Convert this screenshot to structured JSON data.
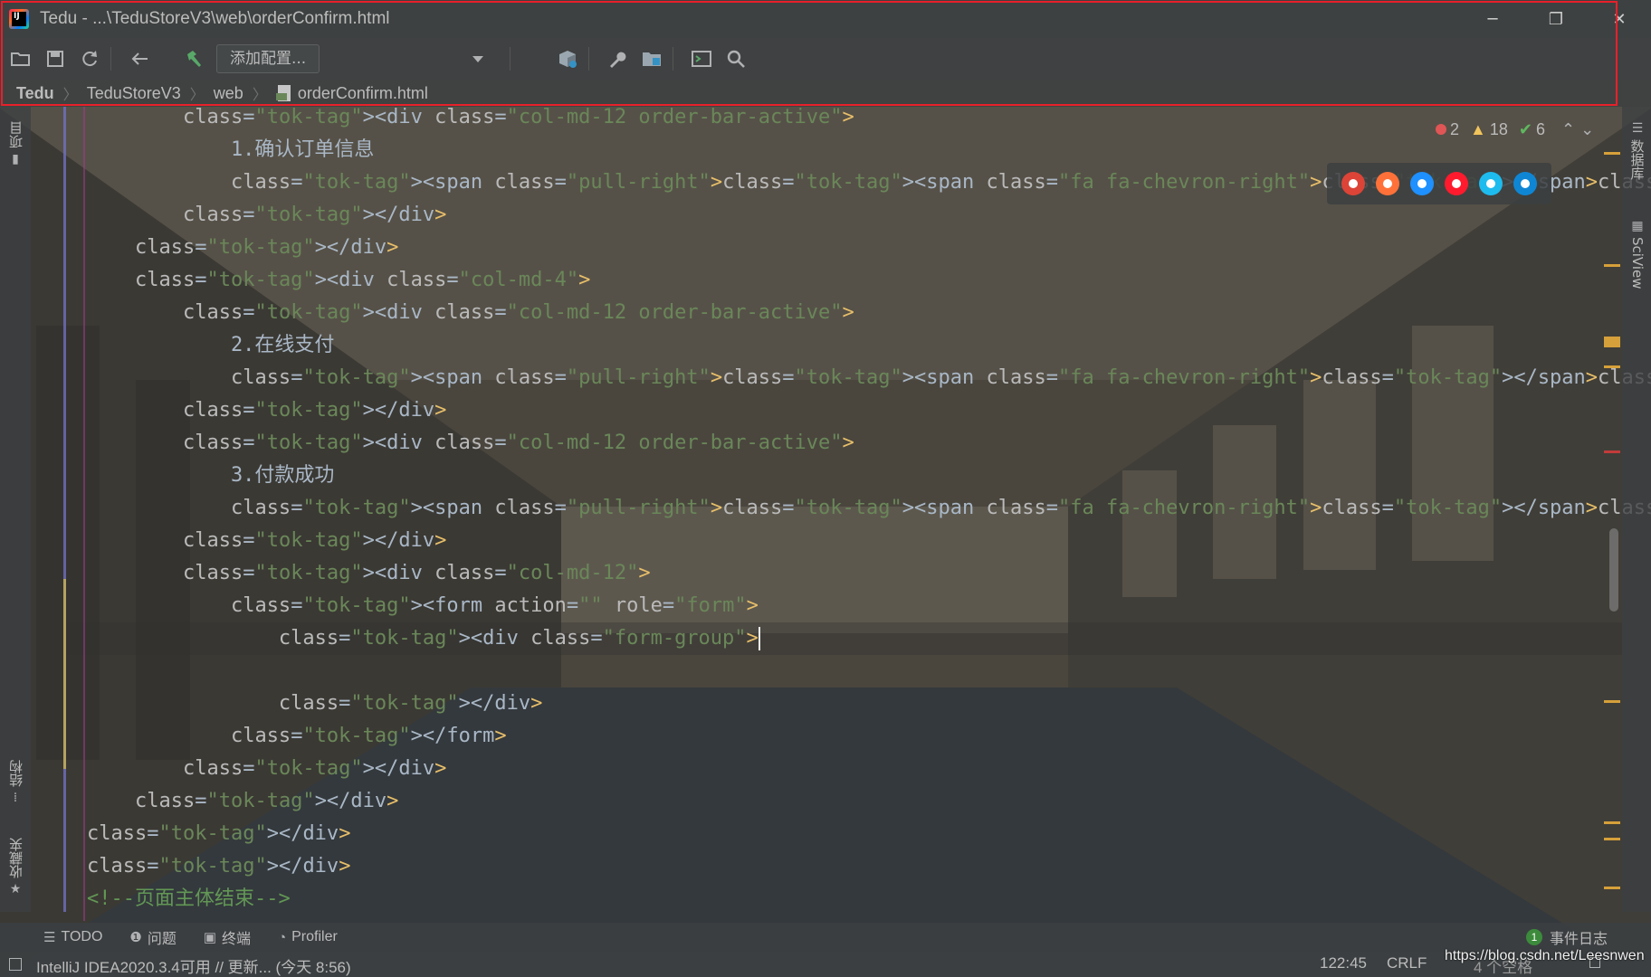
{
  "window": {
    "title": "Tedu - ...\\TeduStoreV3\\web\\orderConfirm.html",
    "logo_text": "IJ",
    "minimize_glyph": "─",
    "maximize_glyph": "❐",
    "close_glyph": "✕"
  },
  "toolbar": {
    "icons": [
      "open-folder-icon",
      "save-icon",
      "sync-icon",
      "back-arrow-icon",
      "build-hammer-icon",
      "run-config-dropdown-icon",
      "package-icon",
      "wrench-icon",
      "project-structure-icon",
      "terminal-icon",
      "search-icon"
    ],
    "run_config_label": "添加配置..."
  },
  "breadcrumb": {
    "items": [
      "Tedu",
      "TeduStoreV3",
      "web",
      "orderConfirm.html"
    ]
  },
  "left_strip": {
    "project_label": "项目",
    "structure_label": "结构",
    "favorites_label": "收藏夹"
  },
  "right_strip": {
    "database_label": "数据库",
    "sciview_label": "SciView"
  },
  "inspections": {
    "errors": "2",
    "warnings": "18",
    "ok": "6"
  },
  "browser_icons": [
    {
      "name": "chrome-icon",
      "color": "#db4437"
    },
    {
      "name": "firefox-icon",
      "color": "#ff7139"
    },
    {
      "name": "safari-icon",
      "color": "#1e90ff"
    },
    {
      "name": "opera-icon",
      "color": "#ff1b2d"
    },
    {
      "name": "internet-explorer-icon",
      "color": "#1ebbee"
    },
    {
      "name": "edge-icon",
      "color": "#0f86d4"
    }
  ],
  "editor": {
    "lines": [
      "        <div class=\"col-md-12 order-bar-active\">",
      "            1.确认订单信息",
      "            <span class=\"pull-right\"><span class=\"fa fa-chevron-right\"></span></span>",
      "        </div>",
      "    </div>",
      "    <div class=\"col-md-4\">",
      "        <div class=\"col-md-12 order-bar-active\">",
      "            2.在线支付",
      "            <span class=\"pull-right\"><span class=\"fa fa-chevron-right\"></span></span>",
      "        </div>",
      "        <div class=\"col-md-12 order-bar-active\">",
      "            3.付款成功",
      "            <span class=\"pull-right\"><span class=\"fa fa-chevron-right\"></span></span>",
      "        </div>",
      "        <div class=\"col-md-12\">",
      "            <form action=\"\" role=\"form\">",
      "                <div class=\"form-group\">",
      "",
      "                </div>",
      "            </form>",
      "        </div>",
      "    </div>",
      "</div>",
      "</div>",
      "<!--页面主体结束-->"
    ],
    "indent_offsets": [
      6,
      6,
      6,
      6,
      4,
      4,
      6,
      6,
      6,
      6,
      6,
      6,
      6,
      6,
      6,
      6,
      6,
      0,
      6,
      6,
      6,
      4,
      2,
      0,
      0
    ]
  },
  "tool_windows": {
    "todo": "TODO",
    "problems": "问题",
    "terminal": "终端",
    "profiler": "Profiler",
    "event_log": "事件日志",
    "event_log_count": "1"
  },
  "status_bar": {
    "message": "IntelliJ IDEA2020.3.4可用 // 更新... (今天 8:56)",
    "position": "122:45",
    "line_ending": "CRLF",
    "indent": "4 个空格"
  },
  "watermark": "https://blog.csdn.net/Leesnwen"
}
